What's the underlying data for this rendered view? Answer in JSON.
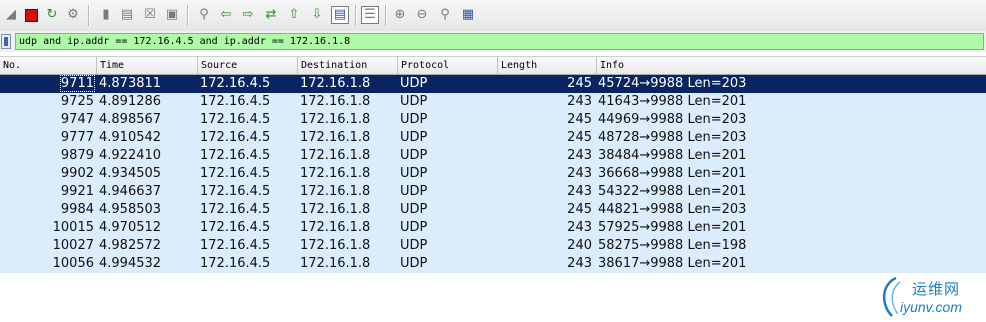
{
  "filter": {
    "value": "udp and ip.addr == 172.16.4.5 and ip.addr == 172.16.1.8"
  },
  "toolbar": {
    "icons": [
      "shark-fin-start-icon",
      "stop-capture-icon",
      "restart-capture-icon",
      "capture-options-icon",
      "open-file-icon",
      "save-file-icon",
      "close-file-icon",
      "reload-file-icon",
      "find-packet-icon",
      "go-back-icon",
      "go-forward-icon",
      "go-to-packet-icon",
      "go-first-icon",
      "go-last-icon",
      "autoscroll-icon",
      "colorize-icon",
      "zoom-in-icon",
      "zoom-out-icon",
      "zoom-normal-icon",
      "resize-columns-icon"
    ]
  },
  "columns": {
    "no": "No.",
    "time": "Time",
    "source": "Source",
    "destination": "Destination",
    "protocol": "Protocol",
    "length": "Length",
    "info": "Info"
  },
  "packets": [
    {
      "no": "9711",
      "time": "4.873811",
      "source": "172.16.4.5",
      "destination": "172.16.1.8",
      "protocol": "UDP",
      "length": "245",
      "info": "45724→9988  Len=203"
    },
    {
      "no": "9725",
      "time": "4.891286",
      "source": "172.16.4.5",
      "destination": "172.16.1.8",
      "protocol": "UDP",
      "length": "243",
      "info": "41643→9988  Len=201"
    },
    {
      "no": "9747",
      "time": "4.898567",
      "source": "172.16.4.5",
      "destination": "172.16.1.8",
      "protocol": "UDP",
      "length": "245",
      "info": "44969→9988  Len=203"
    },
    {
      "no": "9777",
      "time": "4.910542",
      "source": "172.16.4.5",
      "destination": "172.16.1.8",
      "protocol": "UDP",
      "length": "245",
      "info": "48728→9988  Len=203"
    },
    {
      "no": "9879",
      "time": "4.922410",
      "source": "172.16.4.5",
      "destination": "172.16.1.8",
      "protocol": "UDP",
      "length": "243",
      "info": "38484→9988  Len=201"
    },
    {
      "no": "9902",
      "time": "4.934505",
      "source": "172.16.4.5",
      "destination": "172.16.1.8",
      "protocol": "UDP",
      "length": "243",
      "info": "36668→9988  Len=201"
    },
    {
      "no": "9921",
      "time": "4.946637",
      "source": "172.16.4.5",
      "destination": "172.16.1.8",
      "protocol": "UDP",
      "length": "243",
      "info": "54322→9988  Len=201"
    },
    {
      "no": "9984",
      "time": "4.958503",
      "source": "172.16.4.5",
      "destination": "172.16.1.8",
      "protocol": "UDP",
      "length": "245",
      "info": "44821→9988  Len=203"
    },
    {
      "no": "10015",
      "time": "4.970512",
      "source": "172.16.4.5",
      "destination": "172.16.1.8",
      "protocol": "UDP",
      "length": "243",
      "info": "57925→9988  Len=201"
    },
    {
      "no": "10027",
      "time": "4.982572",
      "source": "172.16.4.5",
      "destination": "172.16.1.8",
      "protocol": "UDP",
      "length": "240",
      "info": "58275→9988  Len=198"
    },
    {
      "no": "10056",
      "time": "4.994532",
      "source": "172.16.4.5",
      "destination": "172.16.1.8",
      "protocol": "UDP",
      "length": "243",
      "info": "38617→9988  Len=201"
    }
  ],
  "selected_index": 0,
  "watermark": {
    "top_text": "运维网",
    "bottom_text": "iyunv.com"
  },
  "colors": {
    "filter_valid_bg": "#aefaa6",
    "row_bg": "#dbecfc",
    "selected_bg": "#0a2462"
  }
}
